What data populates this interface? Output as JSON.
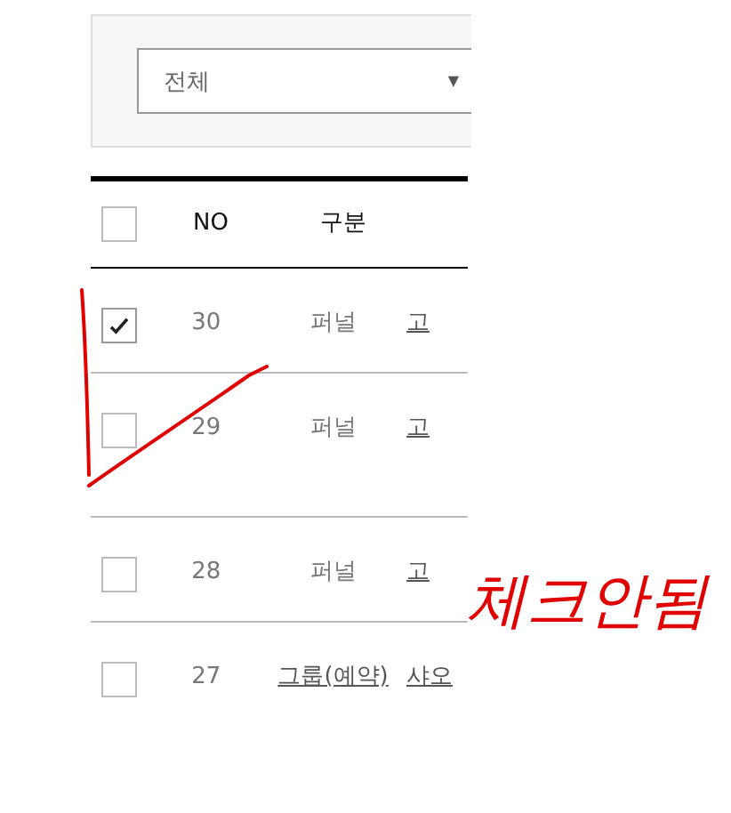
{
  "filter": {
    "select": {
      "value": "전체",
      "caret": "▼"
    }
  },
  "table": {
    "header": {
      "checked": false,
      "columns": [
        "NO",
        "구분"
      ]
    },
    "rows": [
      {
        "checked": true,
        "no": "30",
        "type": "퍼널",
        "type_link": false,
        "column_3": "고"
      },
      {
        "checked": false,
        "no": "29",
        "type": "퍼널",
        "type_link": false,
        "column_3": "고"
      },
      {
        "checked": false,
        "no": "28",
        "type": "퍼널",
        "type_link": false,
        "column_3": "고"
      },
      {
        "checked": false,
        "no": "27",
        "type": "그룹(예약)",
        "type_link": true,
        "column_3": "샤오"
      }
    ]
  },
  "annotation": {
    "text": "체크안됨"
  }
}
